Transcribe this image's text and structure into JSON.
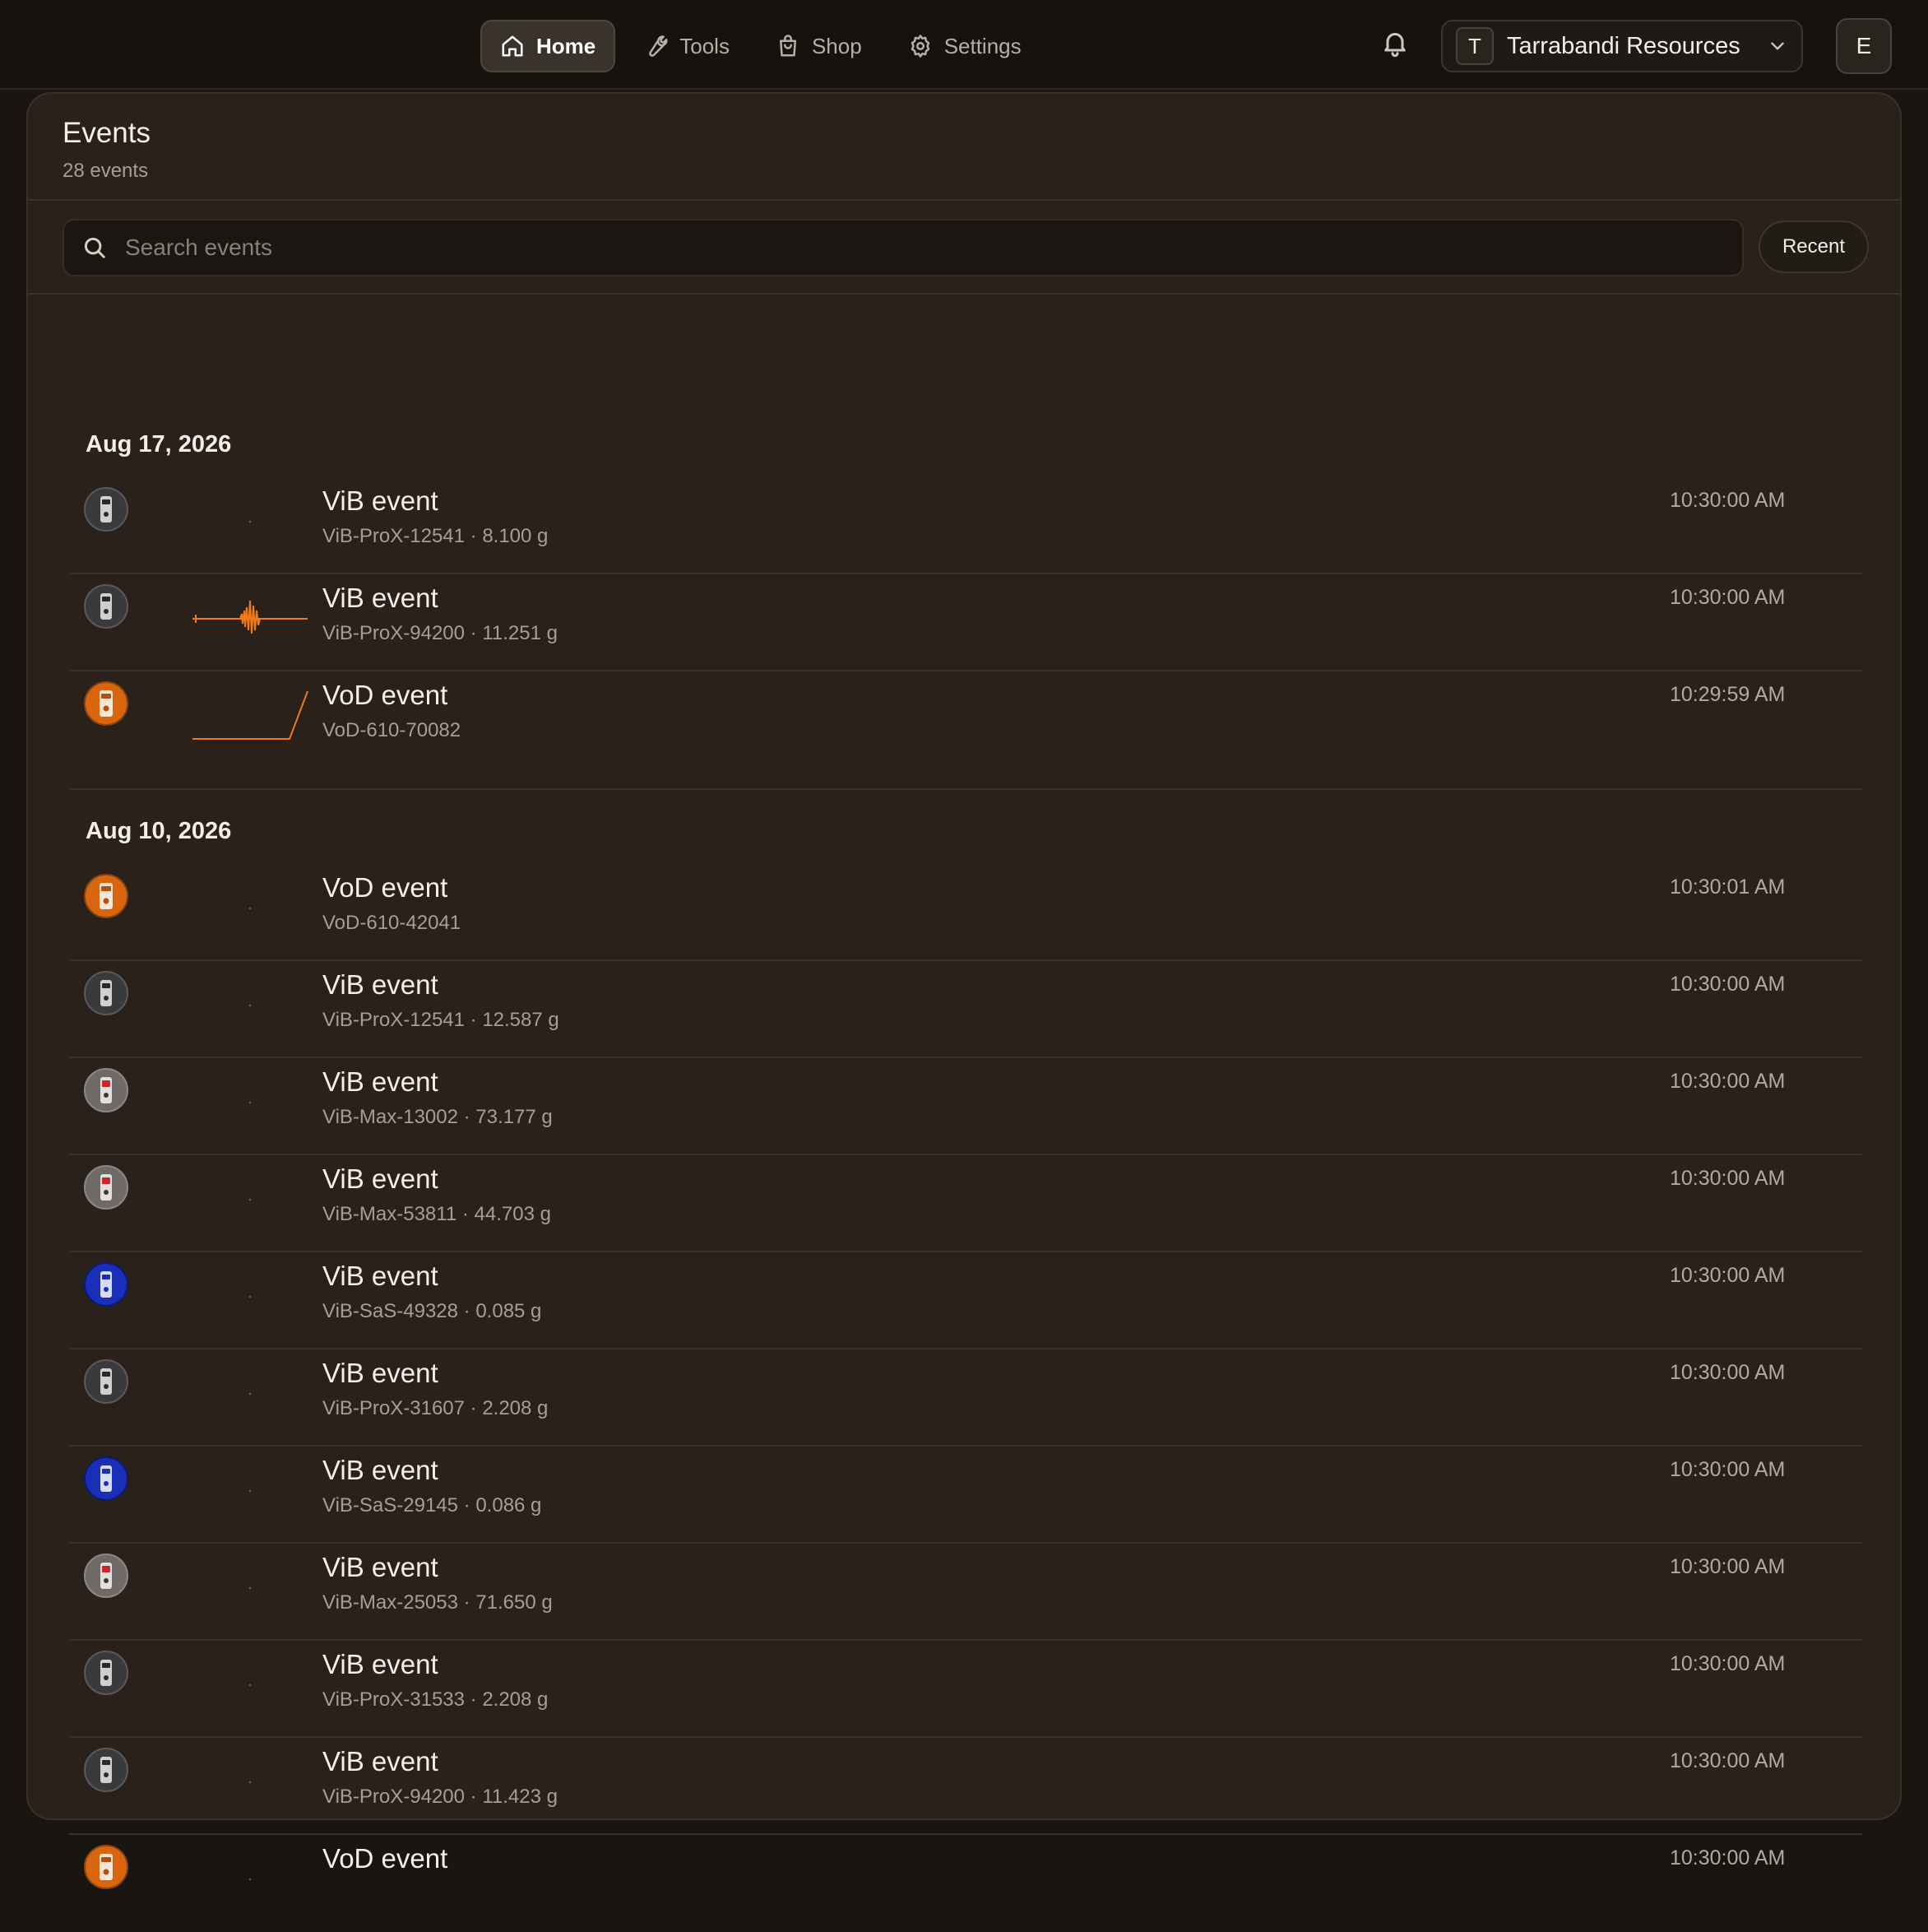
{
  "nav": {
    "items": [
      {
        "label": "Home",
        "icon": "home-icon",
        "active": true
      },
      {
        "label": "Tools",
        "icon": "wrench-icon",
        "active": false
      },
      {
        "label": "Shop",
        "icon": "shopping-bag-icon",
        "active": false
      },
      {
        "label": "Settings",
        "icon": "gear-icon",
        "active": false
      }
    ],
    "bell_icon": "bell-icon",
    "org": {
      "initial": "T",
      "name": "Tarrabandi Resources"
    },
    "user_initial": "E"
  },
  "events": {
    "title": "Events",
    "count_label": "28 events",
    "search_placeholder": "Search events",
    "sort_label": "Recent",
    "groups": [
      {
        "date": "Aug 17, 2026",
        "items": [
          {
            "title": "ViB event",
            "subtitle": "ViB-ProX-12541 · 8.100 g",
            "time": "10:30:00 AM",
            "device": "prox"
          },
          {
            "title": "ViB event",
            "subtitle": "ViB-ProX-94200 · 11.251 g",
            "time": "10:30:00 AM",
            "device": "prox"
          },
          {
            "title": "VoD event",
            "subtitle": "VoD-610-70082",
            "time": "10:29:59 AM",
            "device": "vod"
          }
        ]
      },
      {
        "date": "Aug 10, 2026",
        "items": [
          {
            "title": "VoD event",
            "subtitle": "VoD-610-42041",
            "time": "10:30:01 AM",
            "device": "vod"
          },
          {
            "title": "ViB event",
            "subtitle": "ViB-ProX-12541 · 12.587 g",
            "time": "10:30:00 AM",
            "device": "prox"
          },
          {
            "title": "ViB event",
            "subtitle": "ViB-Max-13002 · 73.177 g",
            "time": "10:30:00 AM",
            "device": "max"
          },
          {
            "title": "ViB event",
            "subtitle": "ViB-Max-53811 · 44.703 g",
            "time": "10:30:00 AM",
            "device": "max"
          },
          {
            "title": "ViB event",
            "subtitle": "ViB-SaS-49328 · 0.085 g",
            "time": "10:30:00 AM",
            "device": "sas"
          },
          {
            "title": "ViB event",
            "subtitle": "ViB-ProX-31607 · 2.208 g",
            "time": "10:30:00 AM",
            "device": "prox"
          },
          {
            "title": "ViB event",
            "subtitle": "ViB-SaS-29145 · 0.086 g",
            "time": "10:30:00 AM",
            "device": "sas"
          },
          {
            "title": "ViB event",
            "subtitle": "ViB-Max-25053 · 71.650 g",
            "time": "10:30:00 AM",
            "device": "max"
          },
          {
            "title": "ViB event",
            "subtitle": "ViB-ProX-31533 · 2.208 g",
            "time": "10:30:00 AM",
            "device": "prox"
          },
          {
            "title": "ViB event",
            "subtitle": "ViB-ProX-94200 · 11.423 g",
            "time": "10:30:00 AM",
            "device": "prox"
          },
          {
            "title": "VoD event",
            "subtitle": "",
            "time": "10:30:00 AM",
            "device": "vod"
          }
        ]
      }
    ]
  },
  "colors": {
    "accent_orange": "#f07a1a",
    "device_prox": "#3a3a3c",
    "device_max": "#6e6a68",
    "device_sas": "#1a2fb8",
    "device_vod": "#d9660f"
  }
}
